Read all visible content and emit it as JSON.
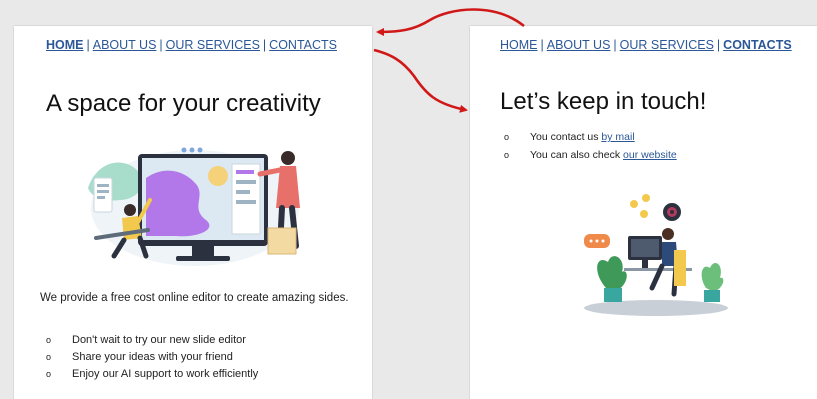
{
  "colors": {
    "link": "#2b5797",
    "arrow": "#d01818"
  },
  "left_page": {
    "nav": {
      "home": "HOME",
      "about": "ABOUT US",
      "services": "OUR SERVICES",
      "contacts": "CONTACTS",
      "separator": "|"
    },
    "heading": "A space for your creativity",
    "illustration": "designer-editing-on-monitor-illustration",
    "paragraph": "We provide a free cost online editor to create amazing sides.",
    "bullets": [
      "Don't wait to try our new slide editor",
      "Share your ideas with your friend",
      "Enjoy our AI support to work efficiently"
    ],
    "bullet_marker": "o"
  },
  "right_page": {
    "nav": {
      "home": "HOME",
      "about": "ABOUT US",
      "services": "OUR SERVICES",
      "contacts": "CONTACTS",
      "separator": "|"
    },
    "heading": "Let’s keep in touch!",
    "illustration": "person-working-at-desk-illustration",
    "bullets": [
      {
        "text": "You contact us ",
        "link": "by mail"
      },
      {
        "text": "You can also check ",
        "link": "our website"
      }
    ],
    "bullet_marker": "o"
  },
  "arrows": [
    {
      "name": "arrow-contacts-to-right-page",
      "from": "left CONTACTS link",
      "to": "right page"
    },
    {
      "name": "arrow-right-page-to-left-contacts",
      "from": "right page",
      "to": "left CONTACTS link"
    }
  ]
}
